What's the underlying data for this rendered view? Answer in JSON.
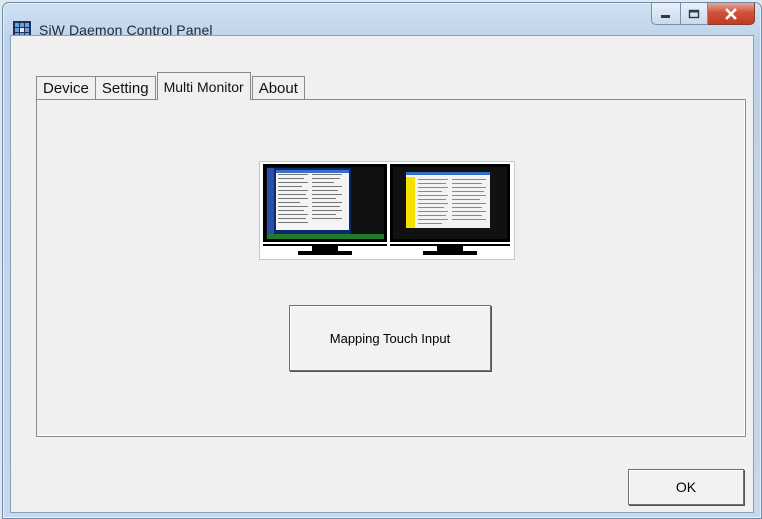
{
  "window": {
    "title": "SiW Daemon Control Panel",
    "app_icon": "grid-app-icon"
  },
  "caption_buttons": {
    "minimize": "minimize-icon",
    "maximize": "maximize-icon",
    "close": "close-icon"
  },
  "tabs": [
    {
      "label": "Device",
      "active": false
    },
    {
      "label": "Setting",
      "active": false
    },
    {
      "label": "Multi Monitor",
      "active": true
    },
    {
      "label": "About",
      "active": false
    }
  ],
  "multi_monitor": {
    "preview": "dual-monitor-preview",
    "mapping_button_label": "Mapping Touch Input"
  },
  "footer": {
    "ok_label": "OK"
  },
  "colors": {
    "close_button": "#c8412a",
    "window_frame": "#bcd2ea",
    "panel": "#f0f0f0"
  }
}
